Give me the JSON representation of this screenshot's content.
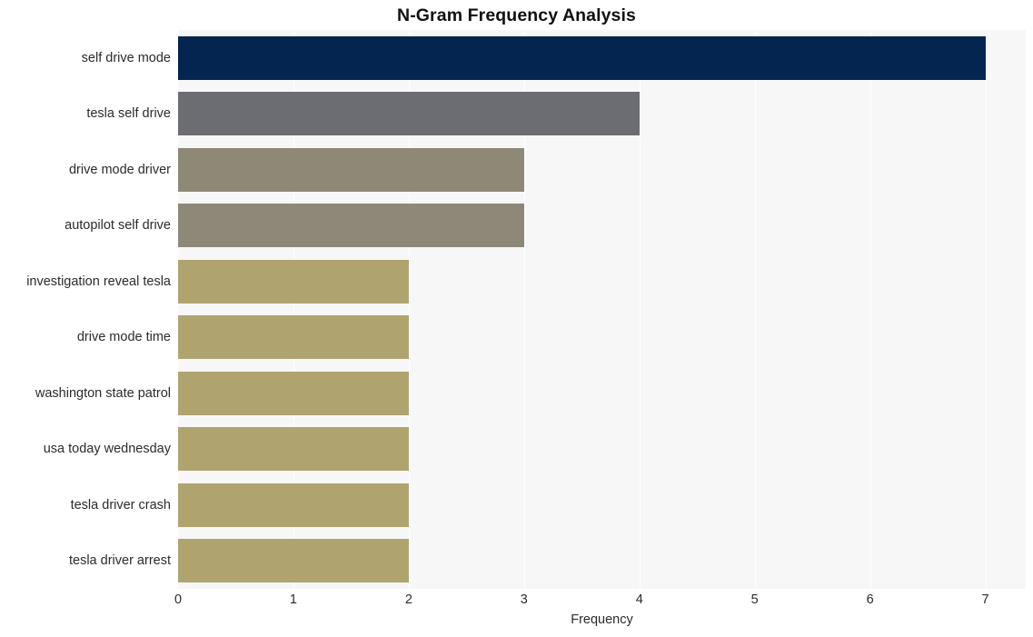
{
  "chart_data": {
    "type": "bar",
    "orientation": "horizontal",
    "title": "N-Gram Frequency Analysis",
    "xlabel": "Frequency",
    "ylabel": "",
    "xlim": [
      0,
      7.35
    ],
    "xticks": [
      0,
      1,
      2,
      3,
      4,
      5,
      6,
      7
    ],
    "xtick_labels": [
      "0",
      "1",
      "2",
      "3",
      "4",
      "5",
      "6",
      "7"
    ],
    "grid": true,
    "grid_axis": "x",
    "legend": false,
    "categories": [
      "self drive mode",
      "tesla self drive",
      "drive mode driver",
      "autopilot self drive",
      "investigation reveal tesla",
      "drive mode time",
      "washington state patrol",
      "usa today wednesday",
      "tesla driver crash",
      "tesla driver arrest"
    ],
    "values": [
      7,
      4,
      3,
      3,
      2,
      2,
      2,
      2,
      2,
      2
    ],
    "bar_colors": [
      "#032550",
      "#6c6d72",
      "#8e8876",
      "#8d8878",
      "#afa470",
      "#afa470",
      "#afa470",
      "#afa470",
      "#afa470",
      "#afa470"
    ],
    "plot_background": "#f7f7f7",
    "figure_background": "#ffffff",
    "gridline_color": "#ffffff",
    "text_color": "#2b2b2b",
    "title_color": "#111111"
  }
}
